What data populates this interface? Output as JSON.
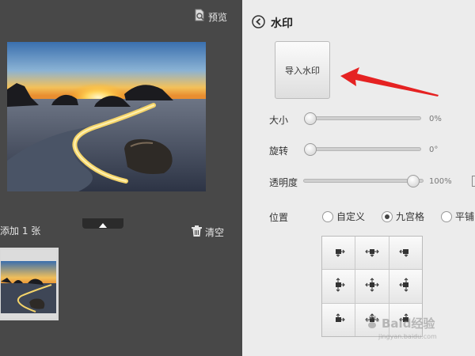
{
  "left_pane": {
    "preview_label": "预览",
    "image_count_text": "添加 1 张",
    "clear_label": "清空"
  },
  "panel": {
    "title": "水印",
    "import_button": "导入水印",
    "size": {
      "label": "大小",
      "value_text": "0%",
      "value": 0
    },
    "rotation": {
      "label": "旋转",
      "value_text": "0°",
      "value": 0
    },
    "opacity": {
      "label": "透明度",
      "value_text": "100%",
      "value": 100
    },
    "position": {
      "label": "位置",
      "options": [
        "自定义",
        "九宫格",
        "平铺"
      ],
      "selected": "九宫格"
    }
  },
  "watermark": {
    "brand": "Baid经验",
    "url": "jingyan.baidu.com"
  },
  "colors": {
    "panel_bg": "#ececec",
    "pane_bg": "#484848",
    "arrow": "#e52222"
  },
  "icons": [
    "preview-icon",
    "back-arrow-icon",
    "trash-icon",
    "triangle-up-icon",
    "arrow-move-icon"
  ]
}
